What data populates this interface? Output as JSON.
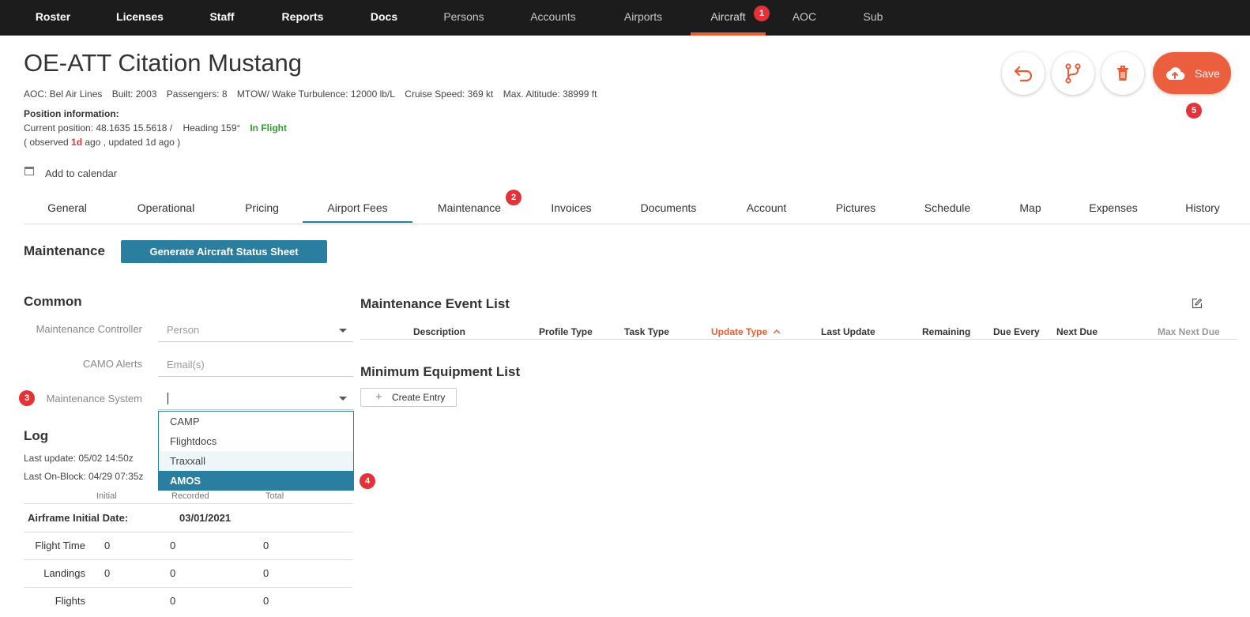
{
  "nav": {
    "items": [
      {
        "label": "Roster"
      },
      {
        "label": "Licenses"
      },
      {
        "label": "Staff"
      },
      {
        "label": "Reports"
      },
      {
        "label": "Docs"
      },
      {
        "label": "Persons"
      },
      {
        "label": "Accounts"
      },
      {
        "label": "Airports"
      },
      {
        "label": "Aircraft"
      },
      {
        "label": "AOC"
      },
      {
        "label": "Sub"
      }
    ],
    "active": "Aircraft"
  },
  "annotations": [
    "1",
    "2",
    "3",
    "4",
    "5"
  ],
  "header": {
    "title": "OE-ATT Citation Mustang",
    "meta": {
      "aoc": "AOC: Bel Air Lines",
      "built": "Built: 2003",
      "passengers": "Passengers: 8",
      "mtow": "MTOW/ Wake Turbulence: 12000 lb/L",
      "cruise": "Cruise Speed: 369 kt",
      "altitude": "Max. Altitude: 38999 ft"
    },
    "position_title": "Position information:",
    "position": "Current position: 48.1635 15.5618 /    Heading 159°",
    "status": "In Flight",
    "observed_prefix": "( observed ",
    "observed_value": "1d",
    "observed_suffix": " ago , updated 1d ago )",
    "calendar_label": "Add to calendar"
  },
  "actions": {
    "save_label": "Save"
  },
  "tabs": [
    {
      "label": "General"
    },
    {
      "label": "Operational"
    },
    {
      "label": "Pricing"
    },
    {
      "label": "Airport Fees"
    },
    {
      "label": "Maintenance"
    },
    {
      "label": "Invoices"
    },
    {
      "label": "Documents"
    },
    {
      "label": "Account"
    },
    {
      "label": "Pictures"
    },
    {
      "label": "Schedule"
    },
    {
      "label": "Map"
    },
    {
      "label": "Expenses"
    },
    {
      "label": "History"
    }
  ],
  "maintenance": {
    "title": "Maintenance",
    "generate_button": "Generate Aircraft Status Sheet",
    "common_title": "Common",
    "fields": {
      "controller_label": "Maintenance Controller",
      "controller_placeholder": "Person",
      "camo_label": "CAMO Alerts",
      "camo_placeholder": "Email(s)",
      "system_label": "Maintenance System",
      "system_value": ""
    },
    "system_options": [
      "CAMP",
      "Flightdocs",
      "Traxxall",
      "AMOS"
    ],
    "selected_option": "AMOS",
    "hovered_option": "Traxxall"
  },
  "log": {
    "title": "Log",
    "last_update": "Last update: 05/02 14:50z",
    "last_onblock": "Last On-Block: 04/29 07:35z",
    "columns": [
      "Initial",
      "Recorded",
      "Total"
    ],
    "airframe_label": "Airframe Initial Date:",
    "airframe_date": "03/01/2021",
    "rows": [
      {
        "label": "Flight Time",
        "initial": "0",
        "recorded": "0",
        "total": "0"
      },
      {
        "label": "Landings",
        "initial": "0",
        "recorded": "0",
        "total": "0"
      },
      {
        "label": "Flights",
        "initial": "",
        "recorded": "0",
        "total": "0"
      }
    ]
  },
  "event_list": {
    "title": "Maintenance Event List",
    "columns": [
      "Description",
      "Profile Type",
      "Task Type",
      "Update Type",
      "Last Update",
      "Remaining",
      "Due Every",
      "Next Due",
      "Max Next Due"
    ],
    "sorted_column": "Update Type"
  },
  "mel": {
    "title": "Minimum Equipment List",
    "create_label": "Create Entry"
  },
  "colors": {
    "accent": "#e85d33",
    "primary": "#2a7fa0",
    "badge": "#e53238",
    "status_green": "#2e9e2e",
    "nav_bg": "#1c1c1c"
  }
}
